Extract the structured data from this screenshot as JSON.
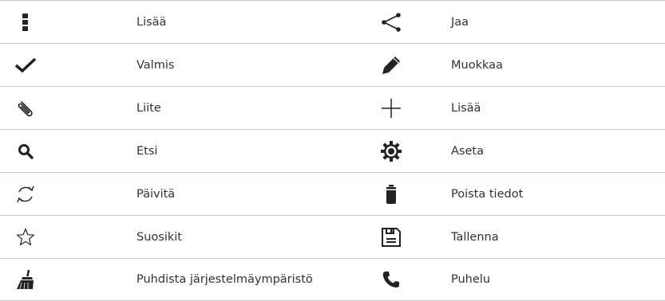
{
  "rows": [
    {
      "left": {
        "icon": "more-icon",
        "label": "Lisää"
      },
      "right": {
        "icon": "share-icon",
        "label": "Jaa"
      }
    },
    {
      "left": {
        "icon": "checkmark-icon",
        "label": "Valmis"
      },
      "right": {
        "icon": "pencil-icon",
        "label": "Muokkaa"
      }
    },
    {
      "left": {
        "icon": "paperclip-icon",
        "label": "Liite"
      },
      "right": {
        "icon": "plus-icon",
        "label": "Lisää"
      }
    },
    {
      "left": {
        "icon": "search-icon",
        "label": "Etsi"
      },
      "right": {
        "icon": "gear-icon",
        "label": "Aseta"
      }
    },
    {
      "left": {
        "icon": "refresh-icon",
        "label": "Päivitä"
      },
      "right": {
        "icon": "trash-icon",
        "label": "Poista tiedot"
      }
    },
    {
      "left": {
        "icon": "star-icon",
        "label": "Suosikit"
      },
      "right": {
        "icon": "save-icon",
        "label": "Tallenna"
      }
    },
    {
      "left": {
        "icon": "broom-icon",
        "label": "Puhdista järjestelmäympäristö"
      },
      "right": {
        "icon": "phone-icon",
        "label": "Puhelu"
      }
    }
  ]
}
